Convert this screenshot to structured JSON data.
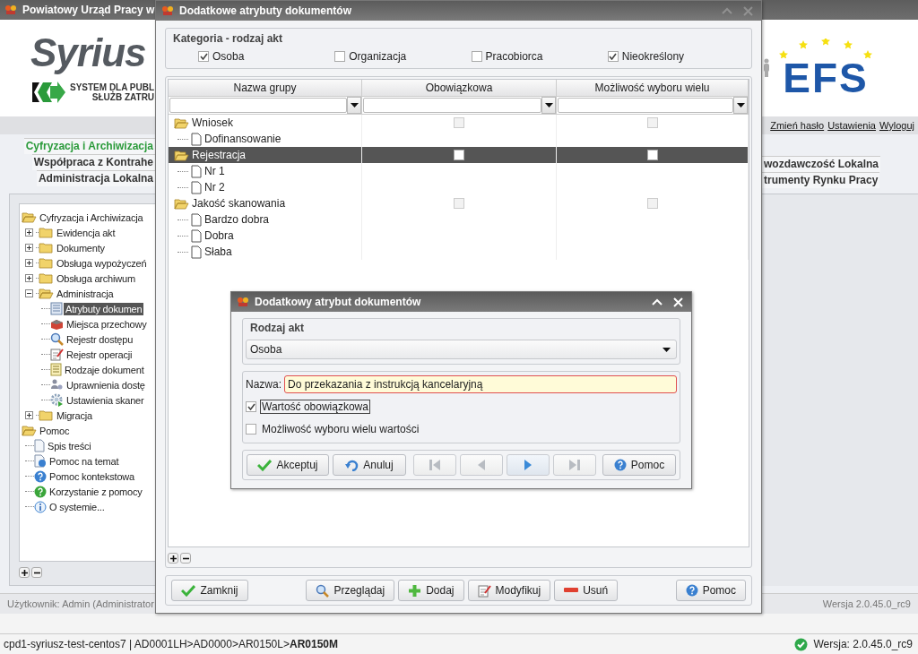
{
  "app": {
    "title": "Powiatowy Urząd Pracy w",
    "logo_text": "Syrius",
    "tagline": [
      "SYSTEM DLA PUBL",
      "SŁUŻB ZATRU"
    ],
    "efs_logo": "EFS"
  },
  "user_links": [
    "Zmień hasło",
    "Ustawienia",
    "Wyloguj"
  ],
  "tabs_left": [
    {
      "label": "Cyfryzacja i Archiwizacja",
      "selected": true
    },
    {
      "label": "Współpraca z Kontrahe",
      "selected": false
    },
    {
      "label": "Administracja Lokalna",
      "selected": false
    }
  ],
  "tabs_right": [
    {
      "label": "wozdawczość Lokalna",
      "selected": false
    },
    {
      "label": "trumenty Rynku Pracy",
      "selected": false
    }
  ],
  "nav_tree": [
    {
      "label": "Cyfryzacja i Archiwizacja",
      "kind": "folder",
      "expanded": true,
      "selected": false,
      "children": [
        {
          "label": "Ewidencja akt",
          "kind": "folder",
          "expanded": false,
          "selected": false
        },
        {
          "label": "Dokumenty",
          "kind": "folder",
          "expanded": false,
          "selected": false
        },
        {
          "label": "Obsługa wypożyczeń",
          "kind": "folder",
          "expanded": false,
          "selected": false
        },
        {
          "label": "Obsługa archiwum",
          "kind": "folder",
          "expanded": false,
          "selected": false
        },
        {
          "label": "Administracja",
          "kind": "folder",
          "expanded": true,
          "selected": false,
          "children": [
            {
              "label": "Atrybuty dokumen",
              "kind": "list",
              "selected": true
            },
            {
              "label": "Miejsca przechowy",
              "kind": "crate",
              "selected": false
            },
            {
              "label": "Rejestr dostępu",
              "kind": "search",
              "selected": false
            },
            {
              "label": "Rejestr operacji",
              "kind": "clipboard",
              "selected": false
            },
            {
              "label": "Rodzaje dokument",
              "kind": "notes",
              "selected": false
            },
            {
              "label": "Uprawnienia dostę",
              "kind": "users",
              "selected": false
            },
            {
              "label": "Ustawienia skaner",
              "kind": "gear",
              "selected": false
            }
          ]
        },
        {
          "label": "Migracja",
          "kind": "folder",
          "expanded": false,
          "selected": false
        }
      ]
    },
    {
      "label": "Pomoc",
      "kind": "folder",
      "expanded": true,
      "selected": false,
      "children": [
        {
          "label": "Spis treści",
          "kind": "page",
          "selected": false
        },
        {
          "label": "Pomoc na temat",
          "kind": "help-page",
          "selected": false
        },
        {
          "label": "Pomoc kontekstowa",
          "kind": "help",
          "selected": false
        },
        {
          "label": "Korzystanie z pomocy",
          "kind": "help-green",
          "selected": false
        },
        {
          "label": "O systemie...",
          "kind": "info",
          "selected": false
        }
      ]
    }
  ],
  "status": {
    "user": "Użytkownik: Admin (Administrator",
    "version": "Wersja 2.0.45.0_rc9"
  },
  "bottom_bar": {
    "path": "cpd1-syriusz-test-centos7 | AD0001LH>AD0000>AR0150L>**AR0150M**",
    "version": "Wersja: 2.0.45.0_rc9"
  },
  "dialog_main": {
    "title": "Dodatkowe atrybuty dokumentów",
    "category": {
      "legend": "Kategoria - rodzaj akt",
      "options": [
        {
          "label": "Osoba",
          "checked": true
        },
        {
          "label": "Organizacja",
          "checked": false
        },
        {
          "label": "Pracobiorca",
          "checked": false
        },
        {
          "label": "Nieokreślony",
          "checked": true
        }
      ]
    },
    "columns": [
      "Nazwa grupy",
      "Obowiązkowa",
      "Możliwość wyboru wielu"
    ],
    "groups": [
      {
        "label": "Wniosek",
        "required": false,
        "multiple": false,
        "selected": false,
        "children": [
          "Dofinansowanie"
        ]
      },
      {
        "label": "Rejestracja",
        "required": false,
        "multiple": false,
        "selected": true,
        "children": [
          "Nr 1",
          "Nr 2"
        ]
      },
      {
        "label": "Jakość skanowania",
        "required": false,
        "multiple": false,
        "selected": false,
        "children": [
          "Bardzo dobra",
          "Dobra",
          "Słaba"
        ]
      }
    ],
    "buttons": [
      {
        "label": "Zamknij",
        "kind": "check"
      },
      {
        "label": "Przeglądaj",
        "kind": "search"
      },
      {
        "label": "Dodaj",
        "kind": "plus"
      },
      {
        "label": "Modyfikuj",
        "kind": "clipboard"
      },
      {
        "label": "Usuń",
        "kind": "minus"
      },
      {
        "label": "Pomoc",
        "kind": "help"
      }
    ]
  },
  "dialog_edit": {
    "title": "Dodatkowy atrybut dokumentów",
    "type_legend": "Rodzaj akt",
    "type_value": "Osoba",
    "name_label": "Nazwa:",
    "name_value": "Do przekazania z instrukcją kancelaryjną",
    "options": [
      {
        "label": "Wartość obowiązkowa",
        "checked": true
      },
      {
        "label": "Możliwość wyboru wielu wartości",
        "checked": false
      }
    ],
    "buttons": [
      {
        "label": "Akceptuj",
        "kind": "check"
      },
      {
        "label": "Anuluj",
        "kind": "undo"
      }
    ],
    "nav": [
      {
        "kind": "first",
        "disabled": true
      },
      {
        "kind": "prev",
        "disabled": true
      },
      {
        "kind": "next",
        "disabled": false
      },
      {
        "kind": "last",
        "disabled": true
      }
    ],
    "help_button": {
      "label": "Pomoc",
      "kind": "help"
    }
  }
}
